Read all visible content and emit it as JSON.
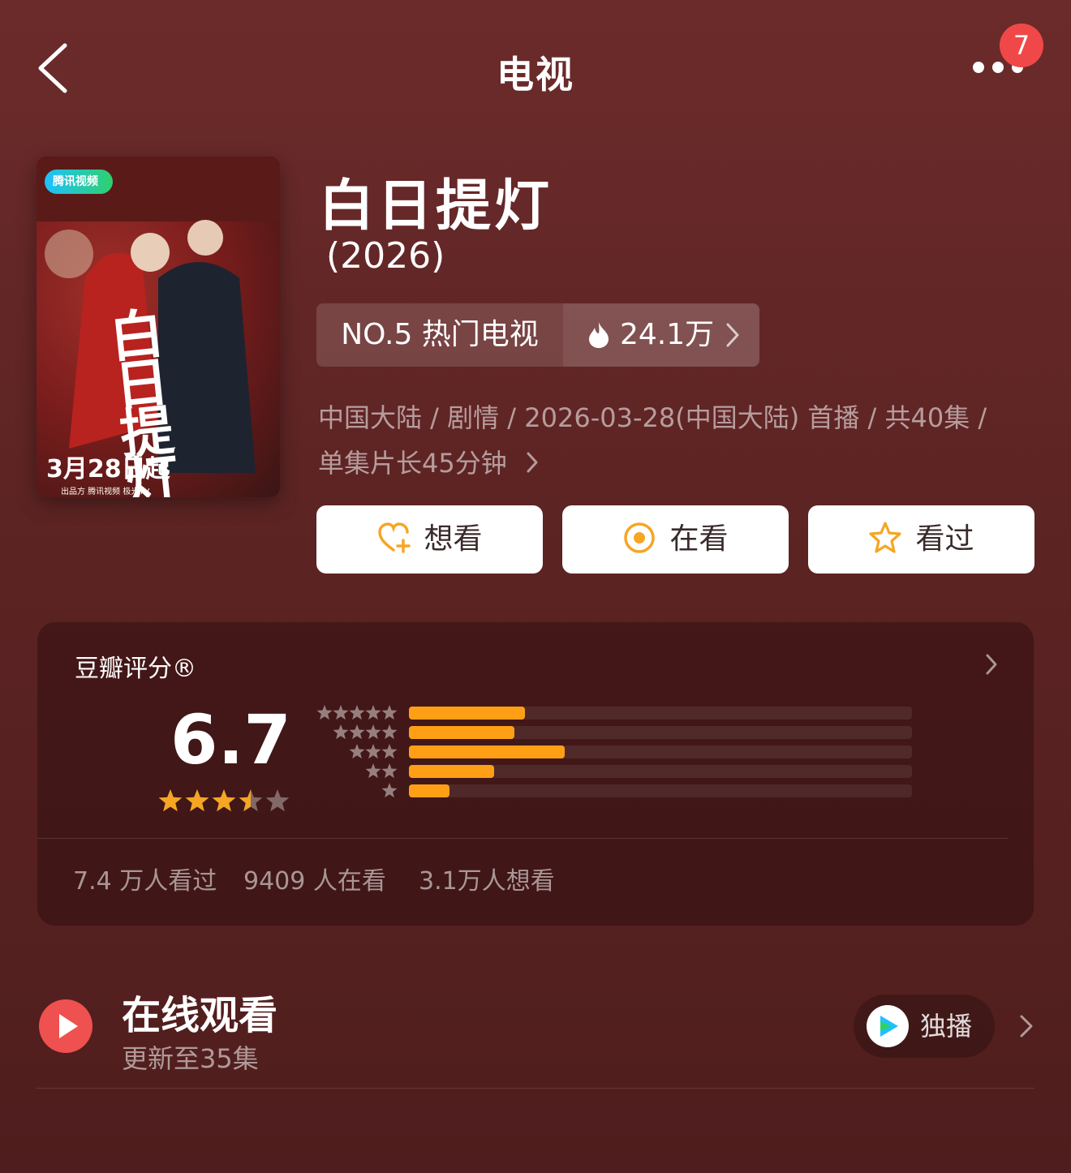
{
  "nav": {
    "title": "电视",
    "badge_count": "7"
  },
  "poster": {
    "platform_logo": "腾讯视频",
    "title_chars": "白日提灯",
    "date_text": "3月28日起",
    "footer": "出品方 腾讯视频 极光TV"
  },
  "show": {
    "title": "白日提灯",
    "year": "(2026)",
    "rank_label": "NO.5 热门电视",
    "heat": "24.1万",
    "meta_line1": "中国大陆 / 剧情 / 2026-03-28(中国大陆) 首播 / 共40集 /",
    "meta_line2": "单集片长45分钟"
  },
  "actions": {
    "want": "想看",
    "watching": "在看",
    "watched": "看过"
  },
  "rating": {
    "title": "豆瓣评分®",
    "score": "6.7",
    "stars_value": 3.5,
    "distribution": [
      {
        "stars": 5,
        "fraction": 0.23
      },
      {
        "stars": 4,
        "fraction": 0.21
      },
      {
        "stars": 3,
        "fraction": 0.31
      },
      {
        "stars": 2,
        "fraction": 0.17
      },
      {
        "stars": 1,
        "fraction": 0.08
      }
    ],
    "watched_count": "7.4 万人看过",
    "watching_count": "9409 人在看",
    "want_count": "3.1万人想看"
  },
  "online": {
    "title": "在线观看",
    "subtitle": "更新至35集",
    "exclusive": "独播"
  },
  "colors": {
    "accent_orange": "#ff9f16",
    "badge_red": "#f04848",
    "play_red": "#ef5050",
    "background": "#5e2424"
  }
}
